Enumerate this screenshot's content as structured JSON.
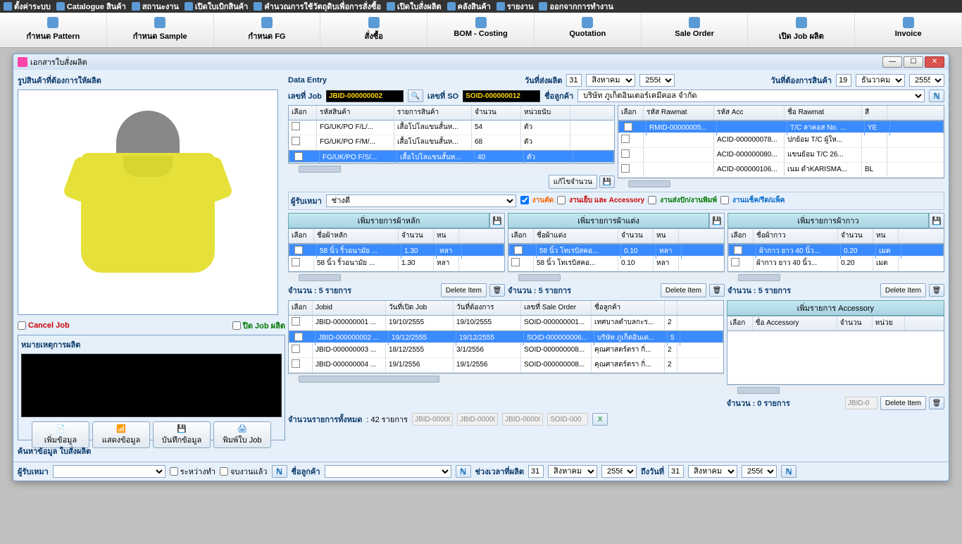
{
  "topmenu": [
    "ตั้งค่าระบบ",
    "Catalogue สินค้า",
    "สถานะงาน",
    "เปิดใบเบิกสินค้า",
    "คำนวณการใช้วัตถุดิบเพื่อการสั่งซื้อ",
    "เปิดใบสั่งผลิต",
    "คลังสินค้า",
    "รายงาน",
    "ออกจากการทำงาน"
  ],
  "ribbon": [
    "กำหนด Pattern",
    "กำหนด Sample",
    "กำหนด FG",
    "สั่งซื้อ",
    "BOM - Costing",
    "Quotation",
    "Sale Order",
    "เปิด Job ผลิต",
    "Invoice"
  ],
  "win_title": "เอกสารใบสั่งผลิต",
  "left": {
    "img_label": "รูปสินค้าที่ต้องการให้ผลิต",
    "cancel": "Cancel Job",
    "close": "ปิด Job ผลิต",
    "notes_title": "หมายเหตุการผลิต",
    "btn1": "เพิ่มข้อมูล",
    "btn2": "แสดงข้อมูล",
    "btn3": "บันทึกข้อมูล",
    "btn4": "พิมพ์ใบ Job",
    "search_label": "ค้นหาข้อมูล ใบสั่งผลิต"
  },
  "head": {
    "data_entry": "Data Entry",
    "send_date": "วันที่ส่งผลิต",
    "send_d": "31",
    "send_m": "สิงหาคม",
    "send_y": "2556",
    "need_date": "วันที่ต้องการสินค้า",
    "need_d": "19",
    "need_m": "ธันวาคม",
    "need_y": "2555",
    "jobno": "เลขที่ Job",
    "jobval": "JBID-000000002",
    "sono": "เลขที่ SO",
    "soval": "SOID-000000012",
    "cust": "ชื่อลูกค้า",
    "custval": "บริษัท ภูเก็ตอินเตอร์เคมีคอล จำกัด"
  },
  "fggrid": {
    "hdr": [
      "เลือก",
      "รหัสสินค้า",
      "รายการสินค้า",
      "จำนวน",
      "หน่วยนับ"
    ],
    "rows": [
      [
        "",
        "FG/UK/PO F/L/...",
        "เสื้อโปโลแขนสั้นห...",
        "54",
        "ตัว"
      ],
      [
        "",
        "FG/UK/PO F/M/...",
        "เสื้อโปโลแขนสั้นห...",
        "68",
        "ตัว"
      ],
      [
        "",
        "FG/UK/PO F/S/...",
        "เสื้อโปโลแขนสั้นห...",
        "40",
        "ตัว"
      ]
    ],
    "sel": 2,
    "fixqty": "แก้ไขจำนวน"
  },
  "rmgrid": {
    "hdr": [
      "เลือก",
      "รหัส Rawmat",
      "รหัส Acc",
      "ชื่อ Rawmat",
      "สี"
    ],
    "rows": [
      [
        "",
        "RMID-00000005...",
        "",
        "T/C ลาคอส No. ...",
        "YE"
      ],
      [
        "",
        "",
        "ACID-000000078...",
        "ปกย้อม T/C ผู้ให...",
        ""
      ],
      [
        "",
        "",
        "ACID-000000080...",
        "แขนย้อม T/C  26...",
        ""
      ],
      [
        "",
        "",
        "ACID-000000106...",
        "เนม ดำKARISMA...",
        "BL"
      ]
    ],
    "sel": 0
  },
  "assign": {
    "label": "ผู้รับเหมา",
    "val": "ช่างตี",
    "c1": "งานตัด",
    "c2": "งานเย็บ และ Accessory",
    "c3": "งานส่งปัก/งานพิมพ์",
    "c4": "งานแช็ค/รีด/แพ็ค"
  },
  "banners": {
    "b1": "เพิ่มรายการผ้าหลัก",
    "b2": "เพิ่มรายการผ้าแต่ง",
    "b3": "เพิ่มรายการผ้ากาว",
    "b4": "เพิ่มรายการ Accessory"
  },
  "sm1": {
    "hdr": [
      "เลือก",
      "ชื่อผ้าหลัก",
      "จำนวน",
      "หน"
    ],
    "rows": [
      [
        "",
        "58 นิ้ว ริ้วอนามัย ...",
        "1.30",
        "หลา"
      ],
      [
        "",
        "58 นิ้ว ริ้วอนามัย ...",
        "1.30",
        "หลา"
      ]
    ],
    "sel": 0,
    "count": "จำนวน : 5 รายการ",
    "del": "Delete Item"
  },
  "sm2": {
    "hdr": [
      "เลือก",
      "ชื่อผ้าแต่ง",
      "จำนวน",
      "หน"
    ],
    "rows": [
      [
        "",
        "58 นิ้ว โทเรบิสคอ...",
        "0.10",
        "หลา"
      ],
      [
        "",
        "58 นิ้ว โทเรบิสคอ...",
        "0.10",
        "หลา"
      ]
    ],
    "sel": 0,
    "count": "จำนวน : 5 รายการ",
    "del": "Delete Item"
  },
  "sm3": {
    "hdr": [
      "เลือก",
      "ชื่อผ้ากาว",
      "จำนวน",
      "หน"
    ],
    "rows": [
      [
        "",
        "ผ้ากาว ยาว 40 นิ้ว...",
        "0.20",
        "เมต"
      ],
      [
        "",
        "ผ้ากาว ยาว 40 นิ้ว...",
        "0.20",
        "เมต"
      ]
    ],
    "sel": 0,
    "count": "จำนวน : 5 รายการ",
    "del": "Delete Item"
  },
  "sm4": {
    "hdr": [
      "เลือก",
      "ชื่อ Accessory",
      "จำนวน",
      "หน่วย"
    ],
    "count": "จำนวน : 0 รายการ",
    "del": "Delete Item"
  },
  "historygrid": {
    "hdr": [
      "เลือก",
      "Jobid",
      "วันที่เปิด Job",
      "วันที่ต้องการ",
      "เลขที่ Sale Order",
      "ชื่อลูกค้า",
      ""
    ],
    "rows": [
      [
        "",
        "JBID-000000001 ...",
        "19/10/2555",
        "19/10/2555",
        "SOID-000000001...",
        "เทศบาลตำบลกะร...",
        "2"
      ],
      [
        "",
        "JBID-000000002 ...",
        "19/12/2555",
        "19/12/2555",
        "SOID-000000006...",
        "บริษัท ภูเก็ตอินเต...",
        "5"
      ],
      [
        "",
        "JBID-000000003 ...",
        "18/12/2555",
        "3/1/2556",
        "SOID-000000008...",
        "คุณศาสตร์ตรา กิ่...",
        "2"
      ],
      [
        "",
        "JBID-000000004 ...",
        "19/1/2556",
        "19/1/2556",
        "SOID-000000008...",
        "คุณศาสตร์ตรา กิ่...",
        "2"
      ]
    ],
    "sel": 1
  },
  "footer": {
    "total": "จำนวนรายการทั้งหมด",
    "totalval": ": 42  รายการ",
    "ph1": "JBID-00000",
    "ph2": "JBID-00000",
    "ph3": "JBID-00000",
    "ph4": "SOID-000",
    "phA": "JBID-0",
    "contractor": "ผู้รับเหมา",
    "between": "ระหว่างทำ",
    "done": "จบงานแล้ว",
    "cust": "ชื่อลูกค้า",
    "range": "ช่วงเวลาที่ผลิต",
    "to": "ถึงวันที่",
    "d1": "31",
    "m1": "สิงหาคม",
    "y1": "2556",
    "d2": "31",
    "m2": "สิงหาคม",
    "y2": "2556"
  }
}
